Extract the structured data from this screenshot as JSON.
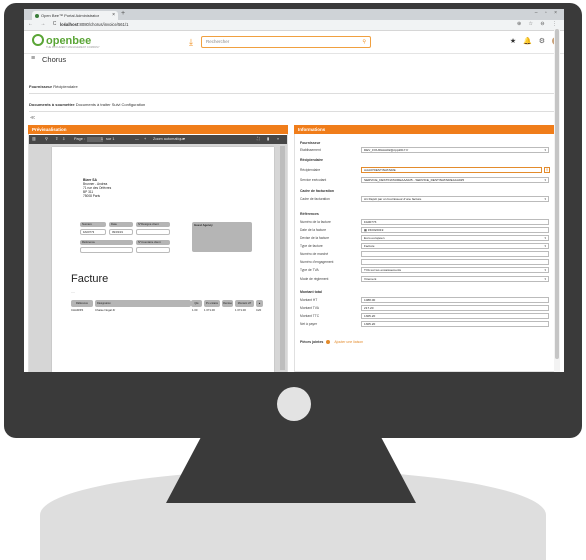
{
  "browser": {
    "tab_title": "Open Bee™ Portal Administrator",
    "tab_close": "×",
    "new_tab": "+",
    "window_controls": "– ▫ ×",
    "nav_icons": "← → C ⌂",
    "url_host": "localhost",
    "url_rest": ":8080/chorus/invoice/561/1",
    "action_icons": "⊕ ☆ ⊖ ⋮"
  },
  "header": {
    "logo_text": "openbee",
    "logo_sub": "THE DOCUMENT MANAGEMENT COMPANY",
    "upload_icon": "⤓",
    "search_placeholder": "Rechercher",
    "search_icon": "⚲",
    "star_icon": "★",
    "bell_icon": "🔔",
    "gear_icon": "⚙"
  },
  "page": {
    "burger": "≡",
    "title": "Chorus",
    "breadcrumb1_bold": "Fournisseur",
    "breadcrumb1_rest": " Récipiendaire",
    "breadcrumb2_bold": "Documents à soumettre",
    "breadcrumb2_rest": " Documents à traiter  Suivi  Configuration",
    "back": "≪"
  },
  "preview": {
    "header": "Prévisualisation",
    "toolbar": {
      "sidebar": "▥",
      "search": "⚲",
      "up": "⇧",
      "down": "⇩",
      "page_label": "Page :",
      "page_value": "1",
      "page_of": "sur 1",
      "zoom_out": "—",
      "zoom_in": "+",
      "zoom": "Zoom automatique",
      "zoom_dd": "▾",
      "fullscreen": "⛶",
      "bookmark": "▮",
      "more": "»"
    },
    "document": {
      "company": "Bizer SA",
      "lines": [
        "Brunner - Andrea",
        "71 rue des Orfèvres",
        "BP 311",
        "75008 Paris"
      ],
      "labels": {
        "numero": "Numéro",
        "date": "Date",
        "client_num": "N°Désigné client",
        "client_name": "Guest Agency",
        "reference": "Référence",
        "client_num2": "N°inventaire client"
      },
      "values": {
        "numero": "FA00773",
        "date": "09/03/19"
      },
      "title": "Facture",
      "dash": "—",
      "table_headers": [
        "Référence",
        "Désignation",
        "Qté",
        "Px unitaire",
        "Remise",
        "Montant HT",
        "▲"
      ],
      "row": [
        "CHAIRP4",
        "Chaise Nogal Zr",
        "1.00",
        "1 071.00",
        "",
        "1 071.00",
        "C20"
      ]
    }
  },
  "informations": {
    "header": "Informations",
    "sections": {
      "fournisseur": "Fournisseur",
      "recipiendaire": "Récipiendaire",
      "cadre": "Cadre de facturation",
      "references": "Références",
      "montant": "Montant total"
    },
    "fields": {
      "etablissement": {
        "label": "Etablissement",
        "value": "DEV_FOURAAA02@cpp2017.fr"
      },
      "recipiendaire": {
        "label": "Récipiendaire",
        "value": "AAA07DESTINATAIRE"
      },
      "service": {
        "label": "Service exécutant",
        "value": "SERVICE_DESTINATAIREAAA025 - SERVICE_DESTINATAIREAAA025"
      },
      "cadre": {
        "label": "Cadre de facturation",
        "value": "A1 Dépôt par un fournisseur d'une facture"
      },
      "numero": {
        "label": "Numéro de la facture",
        "value": "FA00773"
      },
      "date": {
        "label": "Date de la facture",
        "value": "15/03/2019"
      },
      "devise": {
        "label": "Devise de la facture",
        "value": "Euro européen"
      },
      "type": {
        "label": "Type de facture",
        "value": "Facture"
      },
      "marche": {
        "label": "Numéro de marché",
        "value": ""
      },
      "engagement": {
        "label": "Numéro d'engagement",
        "value": ""
      },
      "tva": {
        "label": "Type de TVA",
        "value": "TVA sur les encaissements"
      },
      "reglement": {
        "label": "Mode de règlement",
        "value": "Virement"
      },
      "ht": {
        "label": "Montant HT",
        "value": "1088.00"
      },
      "mtva": {
        "label": "Montant TVA",
        "value": "217.20"
      },
      "ttc": {
        "label": "Montant TTC",
        "value": "1305.20"
      },
      "net": {
        "label": "Net à payer",
        "value": "1305.20"
      }
    },
    "dropdown_icon": "▾",
    "search_btn": "⚲",
    "calendar_icon": "▦",
    "pieces_label": "Pièces jointes",
    "pieces_add": "Ajouter une liaison"
  }
}
